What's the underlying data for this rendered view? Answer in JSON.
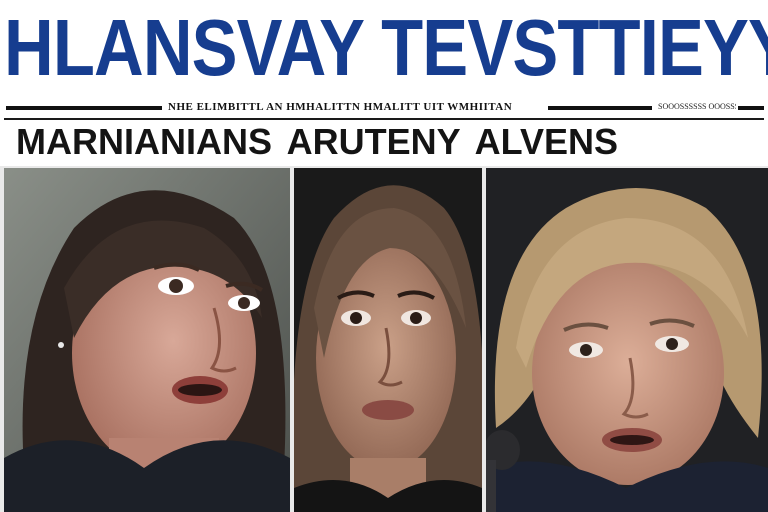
{
  "masthead": {
    "title": "HLANSVAY TEVSTTIEYY",
    "dateline": "NHE ELIMBITTL AN HMHALITTN HMALITT UIT WMHIITAN",
    "edition": "SOOOSSSSSS OOOSSSS"
  },
  "headline": {
    "text": "MARNIANIANS ARUTENY ALVENS"
  },
  "colors": {
    "masthead_blue": "#163d8f",
    "rule_black": "#111111"
  },
  "photos": [
    {
      "subject": "woman-dark-bob-left"
    },
    {
      "subject": "woman-brown-hair-center"
    },
    {
      "subject": "woman-blonde-bob-microphone-right"
    }
  ]
}
